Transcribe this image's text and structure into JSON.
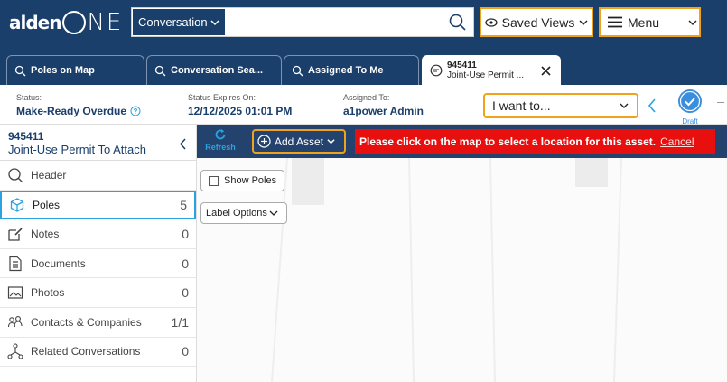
{
  "header": {
    "logo_text": "alden",
    "logo_suffix": "NE",
    "search_type": "Conversation",
    "search_value": "",
    "saved_views_label": "Saved Views",
    "menu_label": "Menu"
  },
  "tabs": [
    {
      "label": "Poles on Map"
    },
    {
      "label": "Conversation Sea..."
    },
    {
      "label": "Assigned To Me"
    },
    {
      "number": "945411",
      "label": "Joint-Use Permit ..."
    }
  ],
  "status_bar": {
    "status_label": "Status:",
    "status_value": "Make-Ready Overdue",
    "expires_label": "Status Expires On:",
    "expires_value": "12/12/2025 01:01 PM",
    "assigned_label": "Assigned To:",
    "assigned_value": "a1power Admin",
    "i_want_label": "I want to...",
    "draft_label": "Draft"
  },
  "sidebar": {
    "number": "945411",
    "title": "Joint-Use Permit To Attach",
    "items": [
      {
        "label": "Header",
        "count": ""
      },
      {
        "label": "Poles",
        "count": "5"
      },
      {
        "label": "Notes",
        "count": "0"
      },
      {
        "label": "Documents",
        "count": "0"
      },
      {
        "label": "Photos",
        "count": "0"
      },
      {
        "label": "Contacts & Companies",
        "count": "1/1"
      },
      {
        "label": "Related Conversations",
        "count": "0"
      }
    ]
  },
  "map_toolbar": {
    "refresh_label": "Refresh",
    "add_asset_label": "Add Asset",
    "alert_text": "Please click on the map to select a location for this asset.",
    "cancel_label": "Cancel"
  },
  "map_controls": {
    "show_poles_label": "Show Poles",
    "label_options_label": "Label Options"
  },
  "colors": {
    "navy": "#1a3f6b",
    "accent_orange": "#f0a21a",
    "alert_red": "#e80f0f",
    "active_blue": "#2aa3e0",
    "draft_blue": "#3b8ede"
  }
}
